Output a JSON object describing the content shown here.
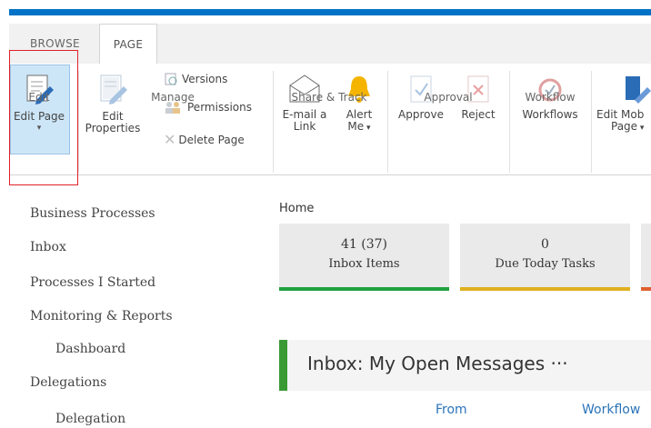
{
  "ribbon": {
    "tabs": [
      "BROWSE",
      "PAGE"
    ],
    "groups": {
      "edit": {
        "label": "Edit",
        "edit_page": "Edit Page"
      },
      "manage": {
        "label": "Manage",
        "edit_properties_1": "Edit",
        "edit_properties_2": "Properties",
        "versions": "Versions",
        "permissions": "Permissions",
        "delete_page": "Delete Page"
      },
      "share": {
        "label": "Share & Track",
        "email_1": "E-mail a",
        "email_2": "Link",
        "alert_1": "Alert",
        "alert_2": "Me"
      },
      "approval": {
        "label": "Approval",
        "approve": "Approve",
        "reject": "Reject"
      },
      "workflow": {
        "label": "Workflow",
        "workflows": "Workflows"
      },
      "mobile": {
        "line1": "Edit Mob",
        "line2": "Page"
      }
    }
  },
  "leftnav": [
    "Business Processes",
    "Inbox",
    "Processes I Started",
    "Monitoring & Reports",
    "Dashboard",
    "Delegations",
    "Delegation"
  ],
  "breadcrumb": "Home",
  "tiles": [
    {
      "num": "41 (37)",
      "label": "Inbox Items",
      "color": "#20a040"
    },
    {
      "num": "0",
      "label": "Due Today Tasks",
      "color": "#e0b020"
    }
  ],
  "panel": {
    "title": "Inbox: My Open Messages  ···",
    "col_from": "From",
    "col_workflow": "Workflow"
  }
}
